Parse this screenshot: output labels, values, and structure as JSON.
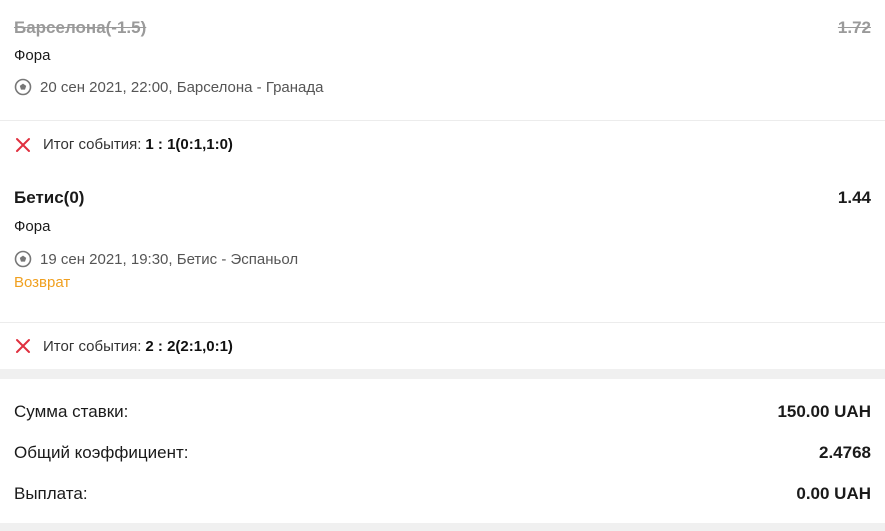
{
  "bets": [
    {
      "name": "Барселона(-1.5)",
      "odds": "1.72",
      "market": "Фора",
      "event": "20 сен 2021, 22:00, Барселона - Гранада",
      "status": "",
      "result_label": "Итог события:",
      "result_score": "1 : 1(0:1,1:0)"
    },
    {
      "name": "Бетис(0)",
      "odds": "1.44",
      "market": "Фора",
      "event": "19 сен 2021, 19:30, Бетис - Эспаньол",
      "status": "Возврат",
      "result_label": "Итог события:",
      "result_score": "2 : 2(2:1,0:1)"
    }
  ],
  "summary": {
    "stake_label": "Сумма ставки:",
    "stake_value": "150.00 UAH",
    "coef_label": "Общий коэффициент:",
    "coef_value": "2.4768",
    "payout_label": "Выплата:",
    "payout_value": "0.00 UAH"
  },
  "colors": {
    "lost_icon": "#e0303f",
    "status_return": "#f0a020",
    "band": "#f0f0f0"
  },
  "icons": {
    "sport": "soccer-ball-icon",
    "result": "close-icon"
  }
}
